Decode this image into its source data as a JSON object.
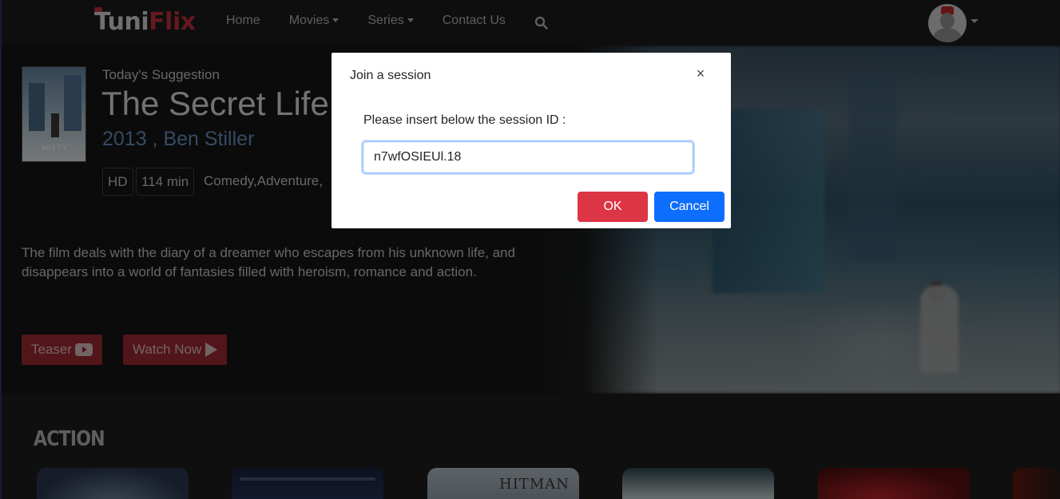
{
  "navbar": {
    "logo_part1": "Tuni",
    "logo_part2": "Flix",
    "links": [
      {
        "label": "Home"
      },
      {
        "label": "Movies"
      },
      {
        "label": "Series"
      },
      {
        "label": "Contact Us"
      }
    ]
  },
  "hero": {
    "suggestion_label": "Today's Suggestion",
    "title": "The Secret Life",
    "meta": "2013 , Ben Stiller",
    "poster_title": "MITTY",
    "tags": [
      "HD",
      "114 min"
    ],
    "genres": "Comedy,Adventure,",
    "description": "The film deals with the diary of a dreamer who escapes from his unknown life, and disappears into a world of fantasies filled with heroism, romance and action.",
    "teaser_label": "Teaser",
    "watch_label": "Watch Now"
  },
  "category": {
    "title": "ACTION",
    "cards": [
      {
        "title": ""
      },
      {
        "title": ""
      },
      {
        "title": "HITMAN"
      },
      {
        "title": ""
      },
      {
        "title": ""
      }
    ]
  },
  "modal": {
    "title": "Join a session",
    "close_glyph": "×",
    "label": "Please insert below the session ID :",
    "input_value": "n7wfOSIEUl.18",
    "ok_label": "OK",
    "cancel_label": "Cancel"
  },
  "colors": {
    "brand_red": "#c9323a",
    "ok_button": "#dc3545",
    "cancel_button": "#0d6efd",
    "meta_blue": "#6d95c4"
  }
}
